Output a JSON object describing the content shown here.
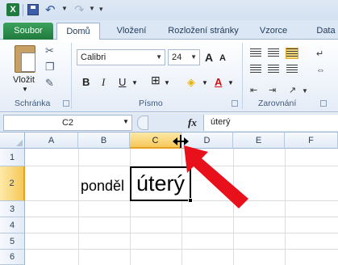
{
  "qat": {
    "app_icon": "X"
  },
  "tabs": {
    "file": "Soubor",
    "home": "Domů",
    "insert": "Vložení",
    "layout": "Rozložení stránky",
    "formulas": "Vzorce",
    "data": "Data"
  },
  "ribbon": {
    "paste": "Vložit",
    "clipboard_label": "Schránka",
    "font_name": "Calibri",
    "font_size": "24",
    "bold": "B",
    "italic": "I",
    "underline": "U",
    "grow": "A",
    "shrink": "A",
    "font_color": "A",
    "font_label": "Písmo",
    "alignment_label": "Zarovnání"
  },
  "formula_bar": {
    "name_box": "C2",
    "fx": "fx",
    "content": "úterý"
  },
  "grid": {
    "columns": [
      "A",
      "B",
      "C",
      "D",
      "E",
      "F"
    ],
    "selected_column": "C",
    "rows": [
      "1",
      "2",
      "3",
      "4",
      "5",
      "6"
    ],
    "selected_row": "2",
    "cells": {
      "B2": "ponděl",
      "C2": "úterý"
    }
  },
  "colors": {
    "accent_green": "#1f7a3e",
    "selection_orange": "#f6c85a",
    "arrow_red": "#e8101a"
  }
}
